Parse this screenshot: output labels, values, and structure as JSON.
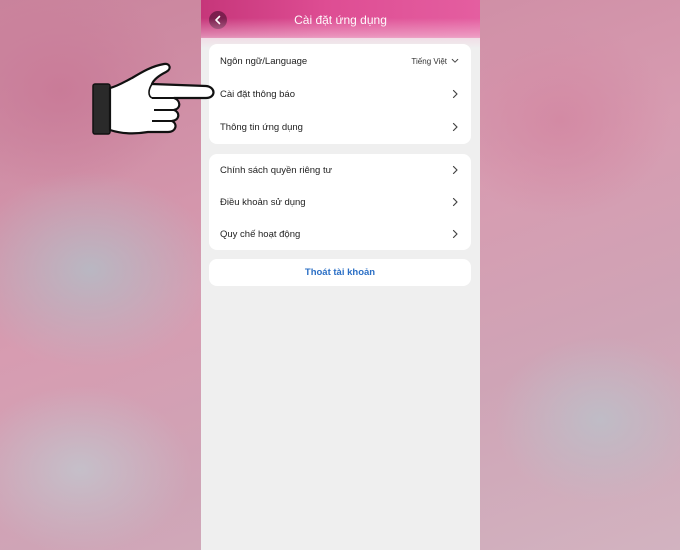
{
  "header": {
    "title": "Cài đặt ứng dụng",
    "back_icon": "chevron-left-icon"
  },
  "settings_group_1": {
    "items": [
      {
        "label": "Ngôn ngữ/Language",
        "value": "Tiếng Việt",
        "icon": "chevron-down-icon"
      },
      {
        "label": "Cài đặt thông báo",
        "icon": "chevron-right-icon"
      },
      {
        "label": "Thông tin ứng dụng",
        "icon": "chevron-right-icon"
      }
    ]
  },
  "settings_group_2": {
    "items": [
      {
        "label": "Chính sách quyền riêng tư",
        "icon": "chevron-right-icon"
      },
      {
        "label": "Điều khoản sử dụng",
        "icon": "chevron-right-icon"
      },
      {
        "label": "Quy chế hoạt động",
        "icon": "chevron-right-icon"
      }
    ]
  },
  "logout": {
    "label": "Thoát tài khoản"
  },
  "colors": {
    "header": "#de4d93",
    "link": "#2b6fc5",
    "background": "#efefef"
  },
  "overlay": {
    "icon": "pointing-hand-icon"
  }
}
